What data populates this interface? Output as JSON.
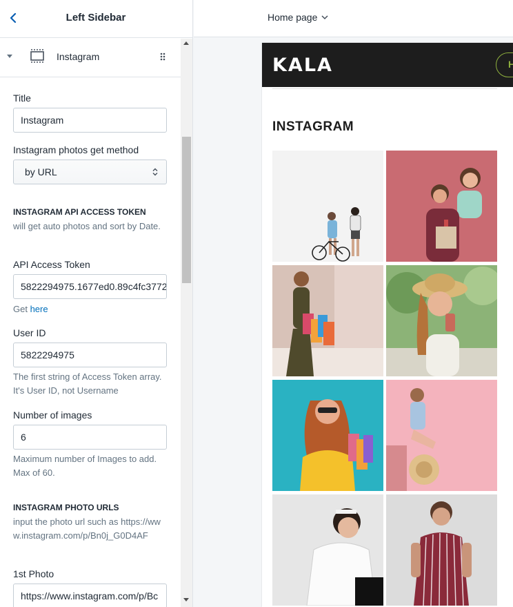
{
  "sidebar": {
    "title": "Left Sidebar",
    "section_label": "Instagram",
    "fields": {
      "title_label": "Title",
      "title_value": "Instagram",
      "method_label": "Instagram photos get method",
      "method_value": "by URL",
      "api_heading": "INSTAGRAM API ACCESS TOKEN",
      "api_help": "will get auto photos and sort by Date.",
      "token_label": "API Access Token",
      "token_value": "5822294975.1677ed0.89c4fc3772",
      "get_prefix": "Get ",
      "get_link": "here",
      "user_label": "User ID",
      "user_value": "5822294975",
      "user_help": "The first string of Access Token array. It's User ID, not Username",
      "count_label": "Number of images",
      "count_value": "6",
      "count_help": "Maximum number of Images to add. Max of 60.",
      "urls_heading": "INSTAGRAM PHOTO URLS",
      "urls_help": "input the photo url such as https://www.instagram.com/p/Bn0j_G0D4AF",
      "photo1_label": "1st Photo",
      "photo1_value": "https://www.instagram.com/p/Bc"
    }
  },
  "topbar": {
    "page_selector": "Home page"
  },
  "preview": {
    "logo": "KALA",
    "header_pill": "H",
    "section_title": "INSTAGRAM",
    "photos": [
      {
        "name": "photo-couple-bicycle",
        "bg": "#f3f3f3"
      },
      {
        "name": "photo-couple-gift",
        "bg": "#c96b72"
      },
      {
        "name": "photo-woman-shopping-bags",
        "bg": "#c8a89a"
      },
      {
        "name": "photo-woman-straw-hat-drink",
        "bg": "#7fa56a"
      },
      {
        "name": "photo-woman-teal-background",
        "bg": "#2ab2c2"
      },
      {
        "name": "photo-woman-pink-background",
        "bg": "#f4b3bd"
      },
      {
        "name": "photo-woman-white-jacket",
        "bg": "#e6e6e6"
      },
      {
        "name": "photo-man-striped-shirt",
        "bg": "#dcdcdc"
      }
    ]
  },
  "colors": {
    "link": "#006fbb",
    "accent": "#8fb03e",
    "header_bg": "#1d1d1d"
  }
}
